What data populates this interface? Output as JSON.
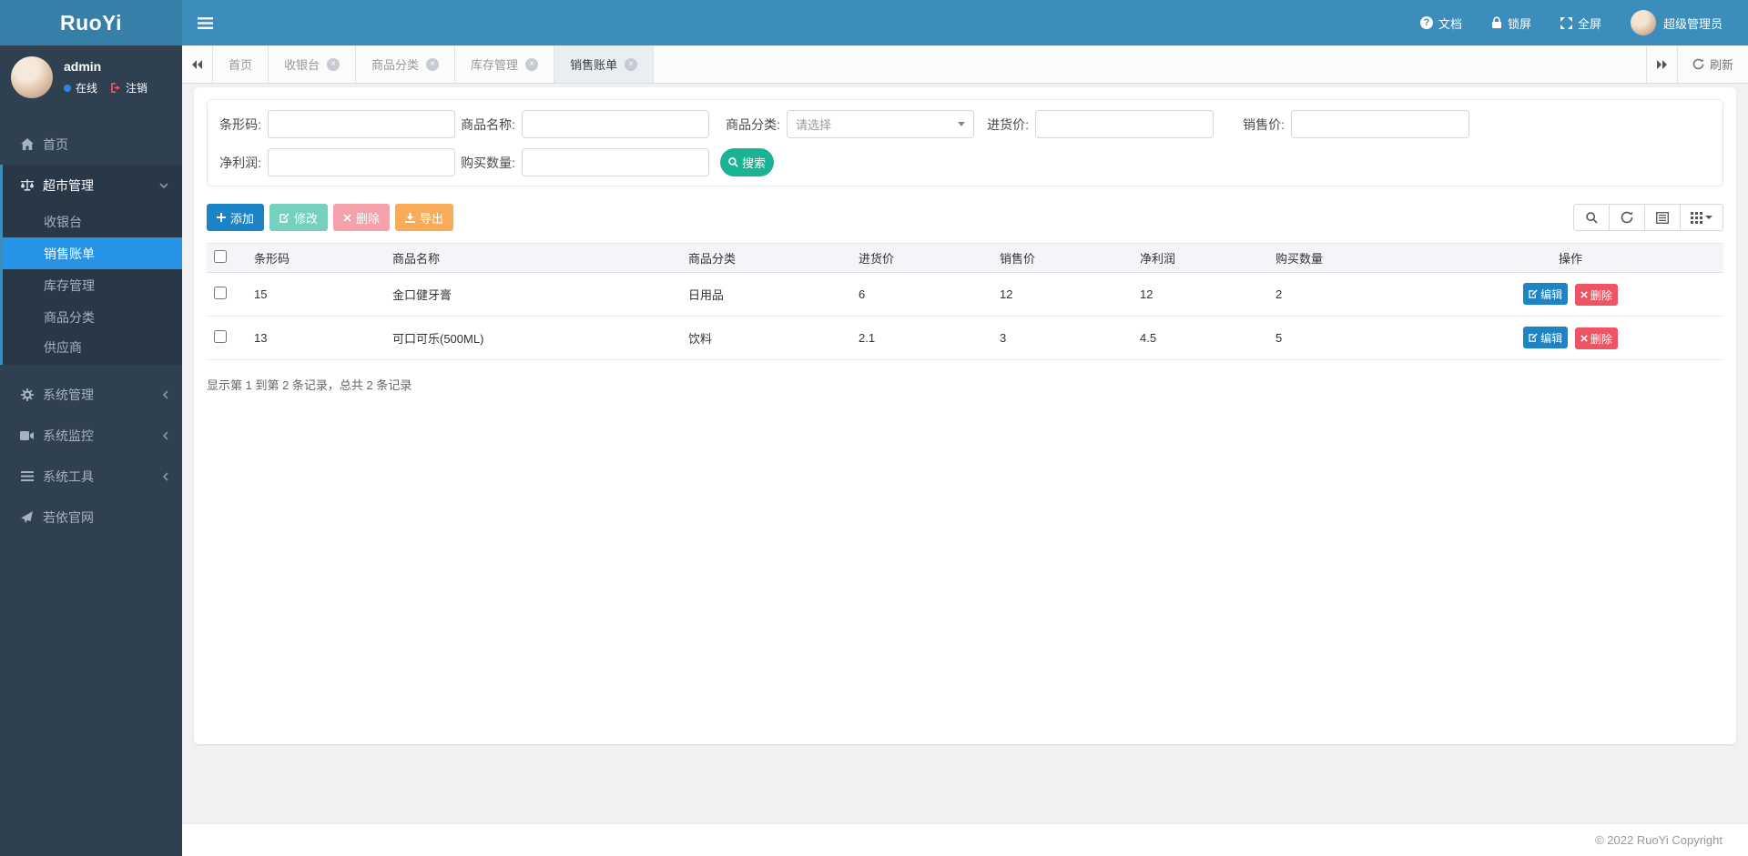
{
  "header": {
    "logo": "RuoYi",
    "nav": {
      "doc": "文档",
      "lock": "锁屏",
      "fullscreen": "全屏"
    },
    "user": {
      "name": "超级管理员"
    }
  },
  "sidebar": {
    "user": {
      "name": "admin",
      "status": "在线",
      "logout": "注销"
    },
    "menu": [
      {
        "label": "首页",
        "icon": "home-icon"
      },
      {
        "label": "超市管理",
        "icon": "balance-scale-icon",
        "expanded": true,
        "children": [
          "收银台",
          "销售账单",
          "库存管理",
          "商品分类",
          "供应商"
        ],
        "active_child": "销售账单"
      },
      {
        "label": "系统管理",
        "icon": "gear-icon"
      },
      {
        "label": "系统监控",
        "icon": "video-camera-icon"
      },
      {
        "label": "系统工具",
        "icon": "bars-icon"
      },
      {
        "label": "若依官网",
        "icon": "paper-plane-icon"
      }
    ]
  },
  "tabs": {
    "items": [
      "首页",
      "收银台",
      "商品分类",
      "库存管理",
      "销售账单"
    ],
    "active": "销售账单",
    "refresh_label": "刷新"
  },
  "search": {
    "fields": [
      {
        "label": "条形码:"
      },
      {
        "label": "商品名称:"
      },
      {
        "label": "商品分类:",
        "type": "select",
        "placeholder": "请选择"
      },
      {
        "label": "进货价:"
      },
      {
        "label": "销售价:"
      },
      {
        "label": "净利润:"
      },
      {
        "label": "购买数量:"
      }
    ],
    "submit_label": "搜索"
  },
  "toolbar": {
    "add_label": "添加",
    "edit_label": "修改",
    "delete_label": "删除",
    "export_label": "导出"
  },
  "table": {
    "columns": [
      "条形码",
      "商品名称",
      "商品分类",
      "进货价",
      "销售价",
      "净利润",
      "购买数量",
      "操作"
    ],
    "rows": [
      {
        "barcode": "15",
        "name": "金口健牙膏",
        "category": "日用品",
        "purchase": "6",
        "sale": "12",
        "profit": "12",
        "qty": "2"
      },
      {
        "barcode": "13",
        "name": "可口可乐(500ML)",
        "category": "饮料",
        "purchase": "2.1",
        "sale": "3",
        "profit": "4.5",
        "qty": "5"
      }
    ],
    "row_actions": {
      "edit": "编辑",
      "delete": "删除"
    },
    "summary": "显示第 1 到第 2 条记录，总共 2 条记录"
  },
  "footer": {
    "copyright": "© 2022 RuoYi Copyright"
  },
  "colors": {
    "header": "#3c8dbc",
    "logo_bg": "#367fa9",
    "sidebar": "#2f4050",
    "sidebar_section": "#293846",
    "active_menu": "#2693e6",
    "primary": "#1c84c6",
    "success": "#1ab394",
    "danger": "#ed5565",
    "warning": "#f8ac59"
  }
}
